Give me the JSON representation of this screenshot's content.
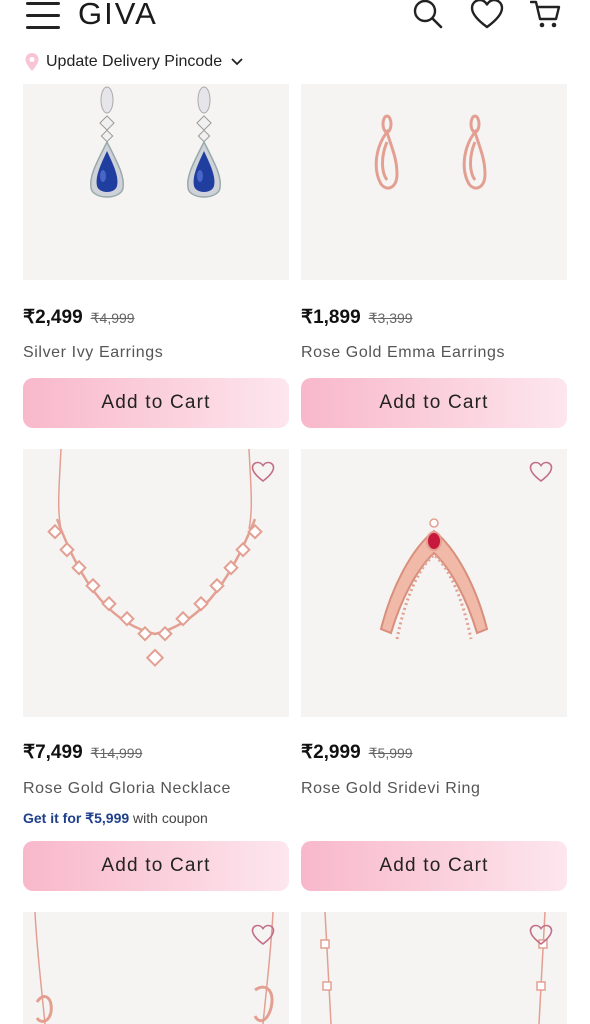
{
  "header": {
    "logo": "GIVA",
    "pincode_label": "Update Delivery Pincode"
  },
  "products": [
    {
      "price": "₹2,499",
      "mrp": "₹4,999",
      "name": "Silver Ivy Earrings",
      "button": "Add to Cart"
    },
    {
      "price": "₹1,899",
      "mrp": "₹3,399",
      "name": "Rose Gold Emma Earrings",
      "button": "Add to Cart"
    },
    {
      "price": "₹7,499",
      "mrp": "₹14,999",
      "name": "Rose Gold Gloria Necklace",
      "coupon_highlight": "Get it for ₹5,999",
      "coupon_rest": " with coupon",
      "button": "Add to Cart"
    },
    {
      "price": "₹2,999",
      "mrp": "₹5,999",
      "name": "Rose Gold Sridevi Ring",
      "button": "Add to Cart"
    }
  ],
  "colors": {
    "accent_pink": "#f8b8cb",
    "coupon_blue": "#1f3f8a",
    "rose_gold": "#e6a394"
  },
  "icons": [
    "menu-icon",
    "search-icon",
    "heart-icon",
    "cart-icon",
    "location-pin-icon",
    "chevron-down-icon",
    "wishlist-heart-icon"
  ]
}
